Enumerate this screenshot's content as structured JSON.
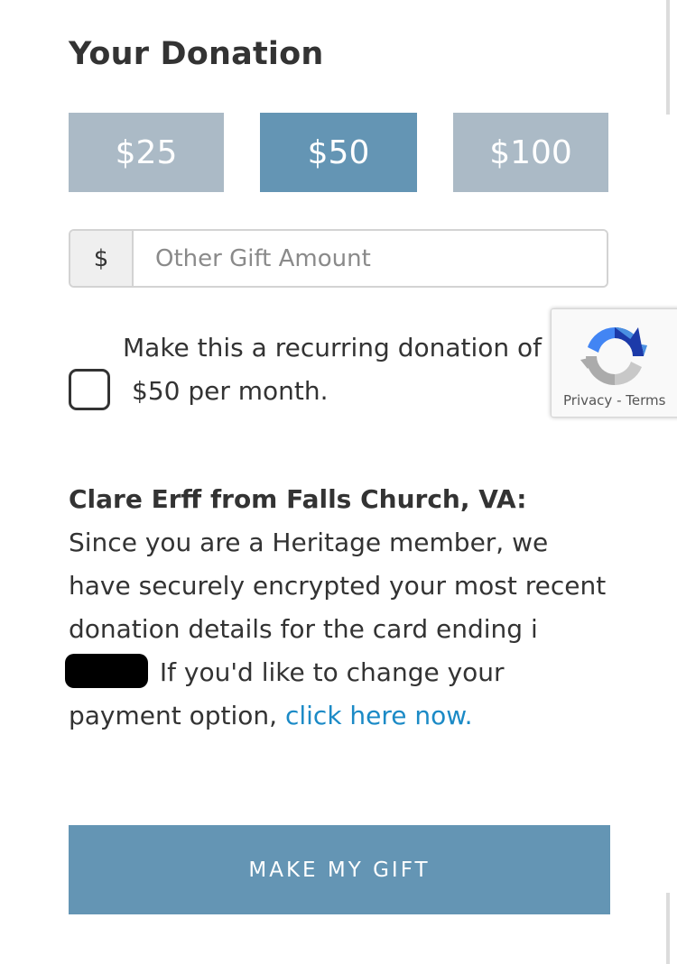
{
  "form": {
    "title": "Your Donation",
    "amounts": [
      "$25",
      "$50",
      "$100"
    ],
    "selected_amount": "$50",
    "other_amount": {
      "prefix": "$",
      "placeholder": "Other Gift Amount",
      "value": ""
    },
    "recurring": {
      "line1": "Make this a recurring donation of",
      "line2": "$50 per month.",
      "checked": false
    },
    "member_notice": {
      "name": "Clare Erff from Falls Church, VA:",
      "text_before": "Since you are a Heritage member, we have securely encrypted your most recent donation details for the card ending i",
      "text_after": " If you'd like to change your payment option, ",
      "link": "click here now."
    },
    "submit_label": "MAKE MY GIFT"
  },
  "recaptcha": {
    "privacy": "Privacy",
    "separator": " - ",
    "terms": "Terms"
  },
  "colors": {
    "selected_button": "#6495b4",
    "unselected_button": "#abbac6",
    "link": "#1b8ac6",
    "text": "#333333"
  }
}
